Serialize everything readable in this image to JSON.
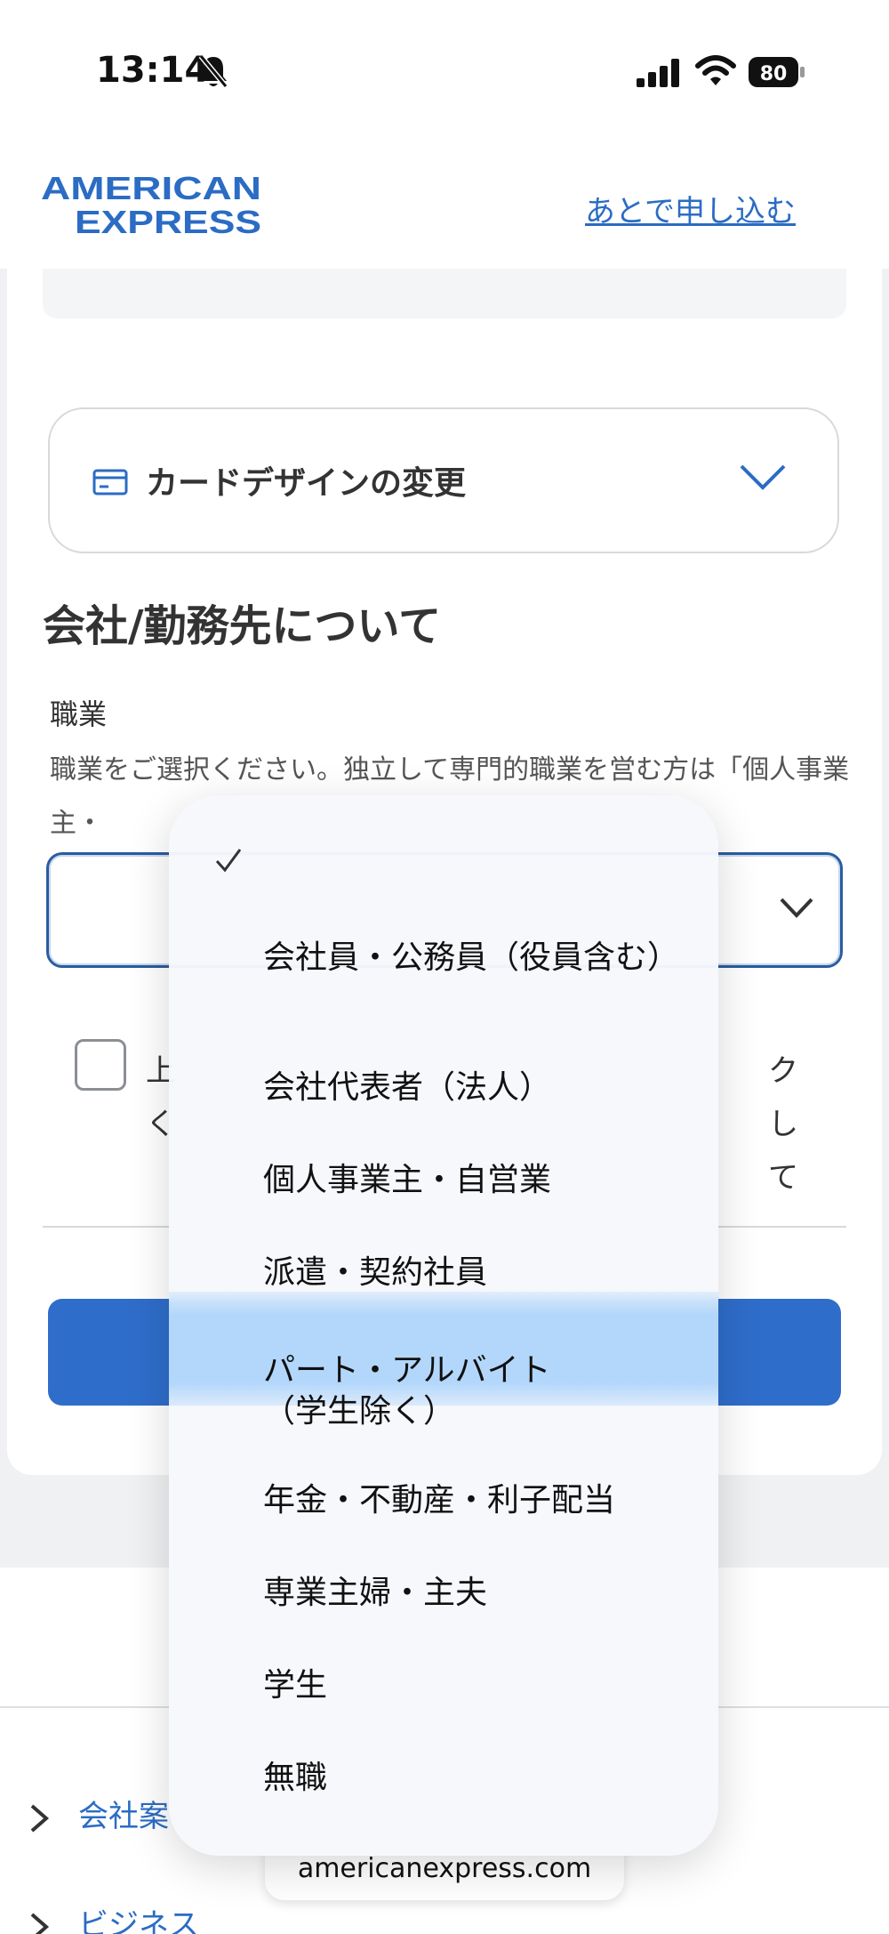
{
  "status_bar": {
    "time": "13:14",
    "battery": "80",
    "icons": [
      "bell-slash-icon",
      "cellular-signal-icon",
      "wifi-icon",
      "battery-icon"
    ]
  },
  "header": {
    "logo_line1": "AMERICAN",
    "logo_line2": "EXPRESS",
    "later_link": "あとで申し込む"
  },
  "card_design": {
    "label": "カードデザインの変更"
  },
  "section": {
    "title": "会社/勤務先について",
    "field_label": "職業",
    "field_help": "職業をご選択ください。独立して専門的職業を営む方は「個人事業主・"
  },
  "consent": {
    "label_visible_start": "上",
    "label_visible_end": "クして",
    "label_line2_start": "く"
  },
  "picker": {
    "options": [
      "会社員・公務員（役員含む）",
      "会社代表者（法人）",
      "個人事業主・自営業",
      "派遣・契約社員",
      "パート・アルバイト（学生除く）",
      "年金・不動産・利子配当",
      "専業主婦・主夫",
      "学生",
      "無職"
    ],
    "highlighted_index": 4
  },
  "footer": {
    "links": [
      "会社案",
      "ビジネス"
    ]
  },
  "browser": {
    "url": "americanexpress.com"
  },
  "colors": {
    "brand_blue": "#2b6cc4",
    "button_blue": "#2f6dcb",
    "highlight": "#b3d7fb"
  }
}
